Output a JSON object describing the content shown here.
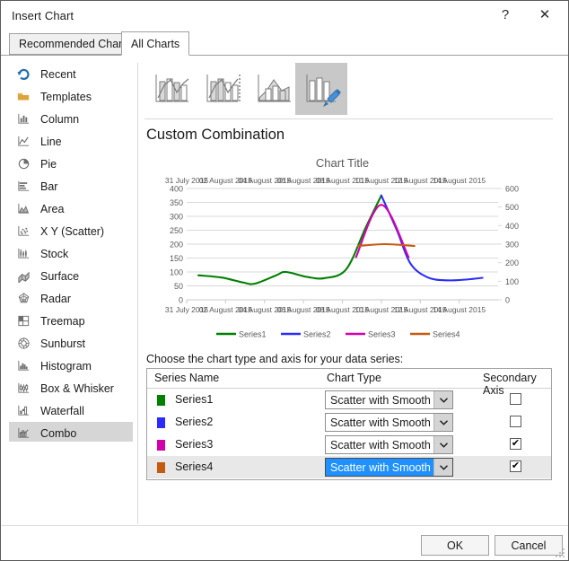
{
  "window": {
    "title": "Insert Chart",
    "help_icon": "help-question-icon",
    "help_glyph": "?",
    "close_icon": "close-icon",
    "close_glyph": "✕"
  },
  "tabs": [
    {
      "label": "Recommended Charts",
      "active": false
    },
    {
      "label": "All Charts",
      "active": true
    }
  ],
  "sidebar": {
    "items": [
      {
        "label": "Recent",
        "icon": "recent-arrow-icon",
        "selected": false
      },
      {
        "label": "Templates",
        "icon": "folder-icon",
        "selected": false
      },
      {
        "label": "Column",
        "icon": "column-chart-icon",
        "selected": false
      },
      {
        "label": "Line",
        "icon": "line-chart-icon",
        "selected": false
      },
      {
        "label": "Pie",
        "icon": "pie-chart-icon",
        "selected": false
      },
      {
        "label": "Bar",
        "icon": "bar-chart-icon",
        "selected": false
      },
      {
        "label": "Area",
        "icon": "area-chart-icon",
        "selected": false
      },
      {
        "label": "X Y (Scatter)",
        "icon": "scatter-chart-icon",
        "selected": false
      },
      {
        "label": "Stock",
        "icon": "stock-chart-icon",
        "selected": false
      },
      {
        "label": "Surface",
        "icon": "surface-chart-icon",
        "selected": false
      },
      {
        "label": "Radar",
        "icon": "radar-chart-icon",
        "selected": false
      },
      {
        "label": "Treemap",
        "icon": "treemap-chart-icon",
        "selected": false
      },
      {
        "label": "Sunburst",
        "icon": "sunburst-chart-icon",
        "selected": false
      },
      {
        "label": "Histogram",
        "icon": "histogram-chart-icon",
        "selected": false
      },
      {
        "label": "Box & Whisker",
        "icon": "boxwhisker-chart-icon",
        "selected": false
      },
      {
        "label": "Waterfall",
        "icon": "waterfall-chart-icon",
        "selected": false
      },
      {
        "label": "Combo",
        "icon": "combo-chart-icon",
        "selected": true
      }
    ]
  },
  "panel": {
    "heading": "Custom Combination",
    "type_buttons": [
      {
        "name": "clustered-column-line-icon",
        "selected": false
      },
      {
        "name": "clustered-column-line-secondary-axis-icon",
        "selected": false
      },
      {
        "name": "stacked-area-clustered-column-icon",
        "selected": false
      },
      {
        "name": "custom-combination-icon",
        "selected": true
      }
    ],
    "choose_label": "Choose the chart type and axis for your data series:",
    "grid_headers": {
      "series_name": "Series Name",
      "chart_type": "Chart Type",
      "secondary_axis": "Secondary Axis"
    },
    "rows": [
      {
        "series": "Series1",
        "color": "#008000",
        "chart_type": "Scatter with Smooth ...",
        "secondary_axis": false,
        "selected": false,
        "focused": false
      },
      {
        "series": "Series2",
        "color": "#2B2BFF",
        "chart_type": "Scatter with Smooth ...",
        "secondary_axis": false,
        "selected": false,
        "focused": false
      },
      {
        "series": "Series3",
        "color": "#D400AE",
        "chart_type": "Scatter with Smooth ...",
        "secondary_axis": true,
        "selected": false,
        "focused": false
      },
      {
        "series": "Series4",
        "color": "#C55A11",
        "chart_type": "Scatter with Smooth ...",
        "secondary_axis": true,
        "selected": true,
        "focused": true
      }
    ],
    "checkmark_glyph": "✔",
    "dropdown_glyph": "⌄"
  },
  "footer": {
    "ok_label": "OK",
    "cancel_label": "Cancel"
  },
  "chart_data": {
    "type": "line",
    "title": "Chart Title",
    "xlabel": "",
    "ylabel": "",
    "grid": true,
    "legend_position": "bottom",
    "x_tick_labels": [
      "31 July 2015",
      "02 August 2015",
      "04 August 2015",
      "06 August 2015",
      "08 August 2015",
      "10 August 2015",
      "12 August 2015",
      "14 August 2015"
    ],
    "x_axis_labels_top": [
      "31 July 2015",
      "02 August 2015",
      "04 August 2015",
      "06 August 2015",
      "08 August 2015",
      "10 August 2015",
      "12 August 2015",
      "14 August 2015"
    ],
    "primary_axis": {
      "side": "left",
      "ylim": [
        0,
        400
      ],
      "ticks": [
        0,
        50,
        100,
        150,
        200,
        250,
        300,
        350,
        400
      ]
    },
    "secondary_axis": {
      "side": "right",
      "ylim": [
        0,
        600
      ],
      "ticks": [
        0,
        100,
        200,
        300,
        400,
        500,
        600
      ]
    },
    "series": [
      {
        "name": "Series1",
        "color": "#008000",
        "axis": "primary",
        "points": [
          {
            "x": 0.3,
            "y": 88
          },
          {
            "x": 0.9,
            "y": 80
          },
          {
            "x": 1.45,
            "y": 62
          },
          {
            "x": 1.75,
            "y": 58
          },
          {
            "x": 2.3,
            "y": 88
          },
          {
            "x": 2.55,
            "y": 100
          },
          {
            "x": 3.1,
            "y": 82
          },
          {
            "x": 3.55,
            "y": 78
          },
          {
            "x": 4.1,
            "y": 110
          },
          {
            "x": 4.6,
            "y": 260
          },
          {
            "x": 5.0,
            "y": 375
          }
        ]
      },
      {
        "name": "Series2",
        "color": "#2B2BFF",
        "axis": "primary",
        "points": [
          {
            "x": 5.0,
            "y": 375
          },
          {
            "x": 5.4,
            "y": 250
          },
          {
            "x": 5.75,
            "y": 130
          },
          {
            "x": 6.2,
            "y": 80
          },
          {
            "x": 6.7,
            "y": 70
          },
          {
            "x": 7.2,
            "y": 73
          },
          {
            "x": 7.6,
            "y": 79
          }
        ]
      },
      {
        "name": "Series3",
        "color": "#D400AE",
        "axis": "secondary",
        "points": [
          {
            "x": 4.35,
            "y": 230
          },
          {
            "x": 5.0,
            "y": 512
          },
          {
            "x": 5.7,
            "y": 230
          }
        ]
      },
      {
        "name": "Series4",
        "color": "#C55A11",
        "axis": "secondary",
        "points": [
          {
            "x": 4.4,
            "y": 290
          },
          {
            "x": 5.1,
            "y": 300
          },
          {
            "x": 5.85,
            "y": 290
          }
        ]
      }
    ],
    "legend": [
      {
        "label": "Series1",
        "color": "#008000"
      },
      {
        "label": "Series2",
        "color": "#2B2BFF"
      },
      {
        "label": "Series3",
        "color": "#D400AE"
      },
      {
        "label": "Series4",
        "color": "#C55A11"
      }
    ]
  }
}
